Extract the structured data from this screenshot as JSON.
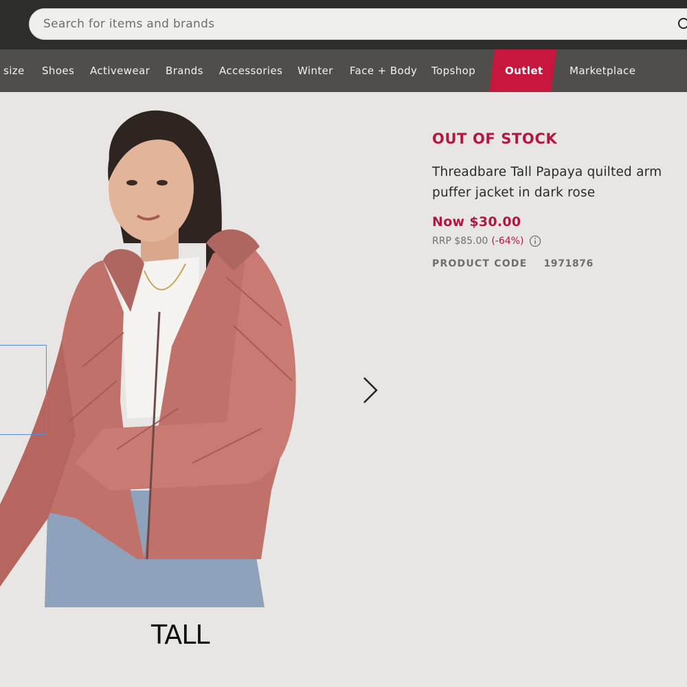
{
  "search": {
    "placeholder": "Search for items and brands",
    "icon": "search-icon"
  },
  "nav": {
    "items": [
      {
        "label": "size"
      },
      {
        "label": "Shoes"
      },
      {
        "label": "Activewear"
      },
      {
        "label": "Brands"
      },
      {
        "label": "Accessories"
      },
      {
        "label": "Winter"
      },
      {
        "label": "Face + Body"
      },
      {
        "label": "Topshop"
      },
      {
        "label": "Outlet"
      },
      {
        "label": "Marketplace"
      }
    ],
    "outlet_color": "#c8173f"
  },
  "gallery": {
    "fit_label": "TALL",
    "next_icon": "chevron-right-icon"
  },
  "product": {
    "stock_status": "OUT OF STOCK",
    "title": "Threadbare Tall Papaya quilted arm puffer jacket in dark rose",
    "price_now": "Now $30.00",
    "rrp": "RRP $85.00",
    "discount": "(-64%)",
    "code_label": "PRODUCT CODE",
    "code_value": "1971876",
    "accent_color": "#b3173f"
  }
}
